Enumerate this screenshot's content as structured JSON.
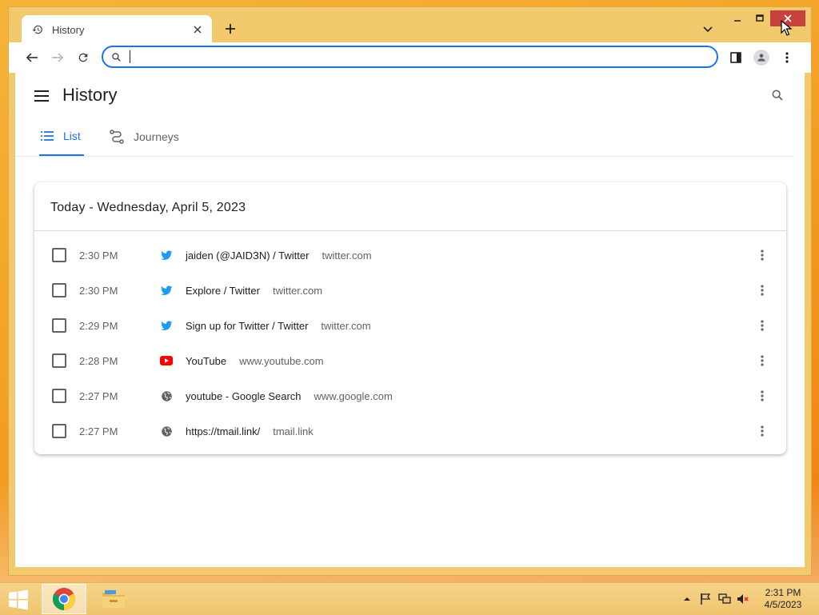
{
  "browser": {
    "tab_title": "History",
    "omnibox_value": "",
    "omnibox_placeholder": ""
  },
  "history_page": {
    "title": "History",
    "tabs": [
      {
        "label": "List",
        "active": true
      },
      {
        "label": "Journeys",
        "active": false
      }
    ],
    "section_title": "Today - Wednesday, April 5, 2023",
    "entries": [
      {
        "time": "2:30 PM",
        "title": "jaiden (@JAIDЗN) / Twitter",
        "domain": "twitter.com",
        "favicon": "twitter-icon"
      },
      {
        "time": "2:30 PM",
        "title": "Explore / Twitter",
        "domain": "twitter.com",
        "favicon": "twitter-icon"
      },
      {
        "time": "2:29 PM",
        "title": "Sign up for Twitter / Twitter",
        "domain": "twitter.com",
        "favicon": "twitter-icon"
      },
      {
        "time": "2:28 PM",
        "title": "YouTube",
        "domain": "www.youtube.com",
        "favicon": "youtube-icon"
      },
      {
        "time": "2:27 PM",
        "title": "youtube - Google Search",
        "domain": "www.google.com",
        "favicon": "globe-icon"
      },
      {
        "time": "2:27 PM",
        "title": "https://tmail.link/",
        "domain": "tmail.link",
        "favicon": "globe-icon"
      }
    ]
  },
  "taskbar": {
    "clock_time": "2:31 PM",
    "clock_date": "4/5/2023"
  },
  "colors": {
    "accent": "#1a73e8",
    "twitter": "#1d9bf0",
    "youtube": "#ff0000",
    "close_button": "#c7423a"
  }
}
